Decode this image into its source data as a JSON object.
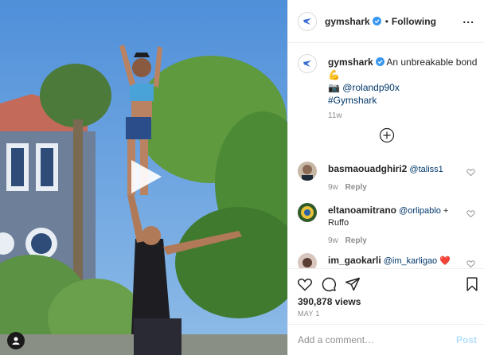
{
  "media": {
    "play_icon": "play-icon",
    "tag_icon": "user-tag-icon"
  },
  "post": {
    "author": "gymshark",
    "follow_dot": "•",
    "follow_status": "Following",
    "more": "...",
    "caption_text": "An unbreakable bond",
    "caption_emoji": "💪",
    "caption_camera": "📷",
    "caption_mention": "@rolandp90x",
    "caption_hashtag": "#Gymshark",
    "caption_time": "11w"
  },
  "comments": [
    {
      "user": "basmaouadghiri2",
      "text": "@taliss1",
      "mention_only": true,
      "time": "9w",
      "reply": "Reply"
    },
    {
      "user": "eltanoamitrano",
      "mention": "@orlipablo",
      "text": "+ Ruffo",
      "time": "9w",
      "reply": "Reply"
    },
    {
      "user": "im_gaokarli",
      "mention": "@im_karligao",
      "emoji": "❤️"
    }
  ],
  "footer": {
    "views": "390,878 views",
    "date": "MAY 1",
    "comment_placeholder": "Add a comment…",
    "post_label": "Post"
  },
  "colors": {
    "link": "#00376b",
    "verified": "#3897f0",
    "post_disabled": "#b2dffc"
  }
}
